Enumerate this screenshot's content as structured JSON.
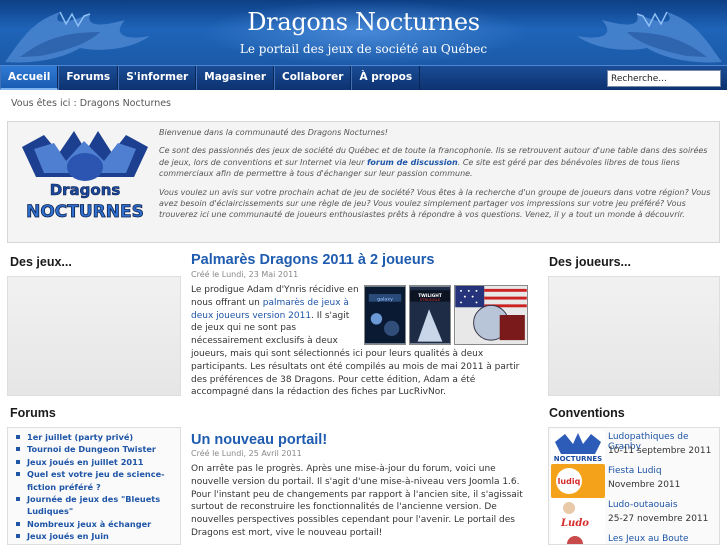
{
  "header": {
    "title": "Dragons Nocturnes",
    "tagline": "Le portail des jeux de société au Québec"
  },
  "nav": {
    "items": [
      "Accueil",
      "Forums",
      "S'informer",
      "Magasiner",
      "Collaborer",
      "À propos"
    ],
    "active": "Accueil",
    "search_value": "Recherche..."
  },
  "breadcrumb": "Vous êtes ici : Dragons Nocturnes",
  "welcome": {
    "p1": "Bienvenue dans la communauté des Dragons Nocturnes!",
    "p2a": "Ce sont des passionnés des jeux de société du Québec et de toute la francophonie. Ils se retrouvent autour d'une table dans des soirées de jeux, lors de conventions et sur Internet via leur ",
    "p2_link": "forum de discussion",
    "p2b": ". Ce site est géré par des bénévoles libres de tous liens commerciaux afin de permettre à tous d'échanger sur leur passion commune.",
    "p3": "Vous voulez un avis sur votre prochain achat de jeu de société? Vous êtes à la recherche d'un groupe de joueurs dans votre région? Vous avez besoin d'éclaircissements sur une règle de jeu? Vous voulez simplement partager vos impressions sur votre jeu préféré? Vous trouverez ici une communauté de joueurs enthousiastes prêts à répondre à vos questions. Venez, il y a tout un monde à découvrir."
  },
  "left": {
    "jeux_heading": "Des jeux...",
    "forums_heading": "Forums",
    "forum_items": [
      "1er juillet (party privé)",
      "Tournoi de Dungeon Twister",
      "Jeux joués en juillet 2011",
      "Quel est votre jeu de science-fiction préféré ?",
      "Journée de jeux des \"Bleuets Ludiques\"",
      "Nombreux jeux à échanger",
      "Jeux joués en Juin"
    ]
  },
  "right": {
    "joueurs_heading": "Des joueurs...",
    "conventions_heading": "Conventions",
    "conventions": [
      {
        "name": "Ludopathiques de Granby",
        "date": "10-11 septembre 2011"
      },
      {
        "name": "Fiesta Ludiq",
        "date": "Novembre 2011"
      },
      {
        "name": "Ludo-outaouais",
        "date": "25-27 novembre 2011"
      },
      {
        "name": "Les Jeux au Boute",
        "date": ""
      }
    ]
  },
  "articles": [
    {
      "title": "Palmarès Dragons 2011 à 2 joueurs",
      "date": "Créé le Lundi, 23 Mai 2011",
      "body_a": "Le prodigue Adam d'Ynris récidive en nous offrant un ",
      "body_link": "palmarès de jeux à deux joueurs version 2011",
      "body_b": ". Il s'agit de jeux qui ne sont pas nécessairement exclusifs à deux joueurs, mais qui sont sélectionnés ici pour leurs qualités à deux participants. Les résultats ont été compilés au mois de mai 2011 à partir des préférences de 38 Dragons. Pour cette édition, Adam a été accompagné dans la rédaction des fiches par LucRivNor."
    },
    {
      "title": "Un nouveau portail!",
      "date": "Créé le Lundi, 25 Avril 2011",
      "body": "On arrête pas le progrès. Après une mise-à-jour du forum, voici une nouvelle version du portail. Il s'agit d'une mise-à-niveau vers Joomla 1.6. Pour l'instant peu de changements par rapport à l'ancien site, il s'agissait surtout de reconstruire les fonctionnalités de l'ancienne version. De nouvelles perspectives possibles cependant pour l'avenir. Le portail des Dragons est mort, vive le nouveau portail!"
    }
  ],
  "game_images": [
    "galaxy-game-cover",
    "twilight-struggle-cover",
    "flag-game-cover"
  ],
  "colors": {
    "header_blue": "#1e64b8",
    "nav_blue": "#0d3270",
    "link_blue": "#1e55a6",
    "title_blue": "#1f5cb0"
  }
}
